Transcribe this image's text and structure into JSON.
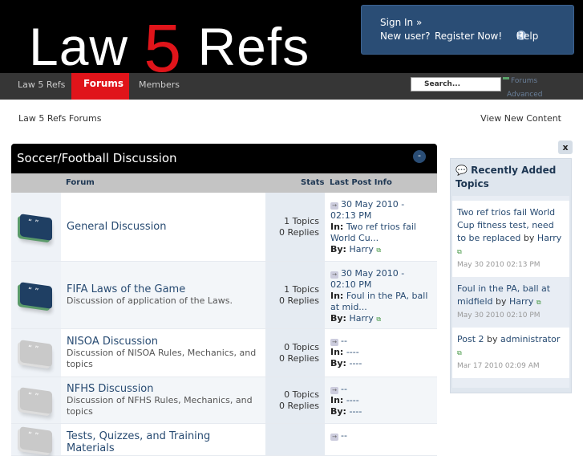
{
  "header": {
    "logo_law": "Law",
    "logo_five": "5",
    "logo_refs": "Refs",
    "sign_in": "Sign In »",
    "new_user": "New user?",
    "register": "Register Now!",
    "help": "Help"
  },
  "nav": {
    "items": [
      "Law 5 Refs",
      "Forums",
      "Members"
    ],
    "search_placeholder": "Search...",
    "search_scope": "Forums",
    "advanced": "Advanced"
  },
  "breadcrumb": "Law 5 Refs Forums",
  "view_new": "View New Content",
  "category": {
    "title": "Soccer/Football Discussion",
    "collapse": "-",
    "columns": {
      "forum": "Forum",
      "stats": "Stats",
      "last": "Last Post Info"
    },
    "forums": [
      {
        "name": "General Discussion",
        "desc": "",
        "topics": "1 Topics",
        "replies": "0 Replies",
        "date": "30 May 2010 - 02:13 PM",
        "in_label": "In:",
        "in": "Two ref trios fail World Cu...",
        "by_label": "By:",
        "by": "Harry"
      },
      {
        "name": "FIFA Laws of the Game",
        "desc": "Discussion of application of the Laws.",
        "topics": "1 Topics",
        "replies": "0 Replies",
        "date": "30 May 2010 - 02:10 PM",
        "in_label": "In:",
        "in": "Foul in the PA, ball at mid...",
        "by_label": "By:",
        "by": "Harry"
      },
      {
        "name": "NISOA Discussion",
        "desc": "Discussion of NISOA Rules, Mechanics, and topics",
        "topics": "0 Topics",
        "replies": "0 Replies",
        "date": "--",
        "in_label": "In:",
        "in": "----",
        "by_label": "By:",
        "by": "----"
      },
      {
        "name": "NFHS Discussion",
        "desc": "Discussion of NFHS Rules, Mechanics, and topics",
        "topics": "0 Topics",
        "replies": "0 Replies",
        "date": "--",
        "in_label": "In:",
        "in": "----",
        "by_label": "By:",
        "by": "----"
      },
      {
        "name": "Tests, Quizzes, and Training Materials",
        "date": "--"
      }
    ]
  },
  "sidebar": {
    "close": "x",
    "title": "Recently Added Topics",
    "items": [
      {
        "title": "Two ref trios fail World Cup fitness test, need to be replaced",
        "by": "by",
        "author": "Harry",
        "date": "May 30 2010 02:13 PM"
      },
      {
        "title": "Foul in the PA, ball at midfield",
        "by": "by",
        "author": "Harry",
        "date": "May 30 2010 02:10 PM"
      },
      {
        "title": "Post 2",
        "by": "by",
        "author": "administrator",
        "date": "Mar 17 2010 02:09 AM"
      }
    ]
  }
}
